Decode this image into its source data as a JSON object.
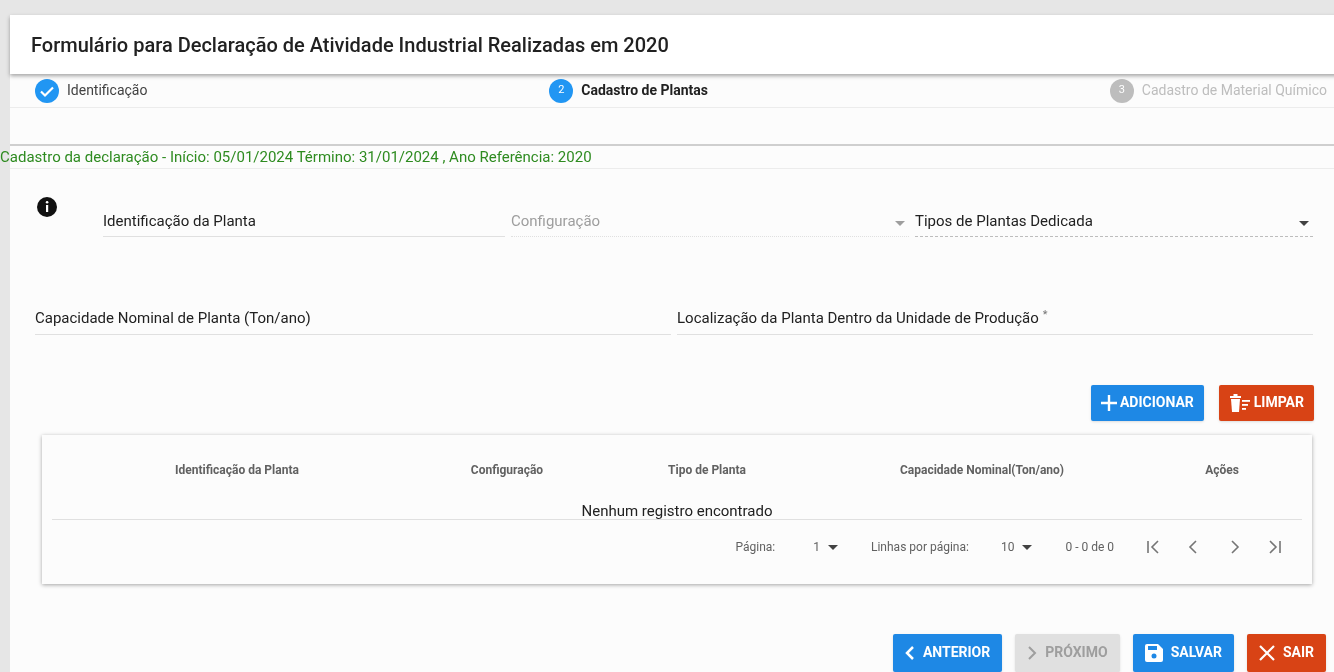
{
  "title": "Formulário para Declaração de Atividade Industrial Realizadas em 2020",
  "steps": [
    {
      "label": "Identificação",
      "completed": true,
      "selected": false
    },
    {
      "number": "2",
      "label": "Cadastro de Plantas",
      "completed": false,
      "selected": true
    },
    {
      "number": "3",
      "label": "Cadastro de Material Químico",
      "completed": false,
      "selected": false
    }
  ],
  "info_line": "Cadastro da declaração - Início: 05/01/2024 Término: 31/01/2024 , Ano Referência: 2020",
  "fields_row1": [
    {
      "kind": "text",
      "label": "Identificação da Planta",
      "disabled": false
    },
    {
      "kind": "select",
      "label": "Configuração",
      "disabled": true
    },
    {
      "kind": "select",
      "label": "Tipos de Plantas Dedicada",
      "disabled": false
    }
  ],
  "fields_row2": [
    {
      "label": "Capacidade Nominal de Planta (Ton/ano)",
      "disabled": false
    },
    {
      "label": "Localização da Planta Dentro da Unidade de Produção",
      "disabled": false,
      "required_mark": "*"
    }
  ],
  "form_buttons": [
    {
      "kind": "add",
      "label": "ADICIONAR"
    },
    {
      "kind": "clear",
      "label": "LIMPAR"
    }
  ],
  "table": {
    "columns": [
      "Identificação da Planta",
      "Configuração",
      "Tipo de Planta",
      "Capacidade Nominal(Ton/ano)",
      "Ações"
    ],
    "empty_message": "Nenhum registro encontrado",
    "pagination": {
      "page_label": "Página:",
      "page": "1",
      "rows_label": "Linhas por página:",
      "rows": "10",
      "range": "0 - 0 de 0"
    }
  },
  "nav_buttons": [
    {
      "kind": "prev",
      "label": "ANTERIOR",
      "disabled": false
    },
    {
      "kind": "next",
      "label": "PRÓXIMO",
      "disabled": true
    },
    {
      "kind": "save",
      "label": "SALVAR",
      "disabled": false
    },
    {
      "kind": "exit",
      "label": "SAIR",
      "disabled": false
    }
  ]
}
